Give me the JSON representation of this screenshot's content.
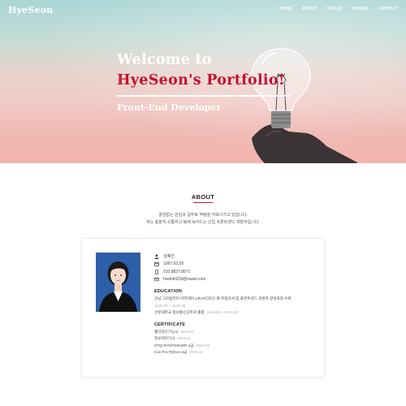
{
  "nav": {
    "logo": "HyeSeon",
    "items": [
      "HOME",
      "ABOUT",
      "SKILLS",
      "WORKS",
      "CONTACT"
    ]
  },
  "hero": {
    "line1": "Welcome to",
    "line2": "HyeSeon's Portfolio!",
    "subtitle": "Front-End Developer"
  },
  "about": {
    "title": "ABOUT",
    "desc1": "끊임없는 관심과 공부로 역량을 키워나가고 있습니다.",
    "desc2": "저는 충분히 소통하고 팀에 녹아드는 신입 프론트엔드 개발자입니다."
  },
  "profile": {
    "name": "심혜선",
    "birth": "1997.03.29",
    "phone": "010.8837.8971",
    "email": "hsshim319@naver.com",
    "education_title": "EDUCATION",
    "education": [
      {
        "text": "강남 그린컴퓨터 아카데미 UI/UX디자인 웹 퍼블리셔 및 프론트엔드 개발자 양성과정 수료",
        "date": "2020.02 ~ 2020.08"
      },
      {
        "text": "선문대학교 정보통신공학과 졸업",
        "date": "2016.03 ~ 2020.02"
      }
    ],
    "certificate_title": "CERTIFICATE",
    "certificates": [
      {
        "text": "웹디자인기능사",
        "date": "2020.07"
      },
      {
        "text": "정보처리기사",
        "date": "2019.11"
      },
      {
        "text": "GTQ PHOTOSHOP 1급",
        "date": "2019.03"
      },
      {
        "text": "Cos Pro Python 2급",
        "date": "2019.12"
      }
    ]
  },
  "colors": {
    "accent": "#c8102e",
    "hero_top": "#a9d6d5",
    "hero_bottom": "#f2b5ae"
  },
  "icons": {
    "name": "user-icon",
    "birth": "calendar-icon",
    "phone": "phone-icon",
    "email": "mail-icon"
  }
}
